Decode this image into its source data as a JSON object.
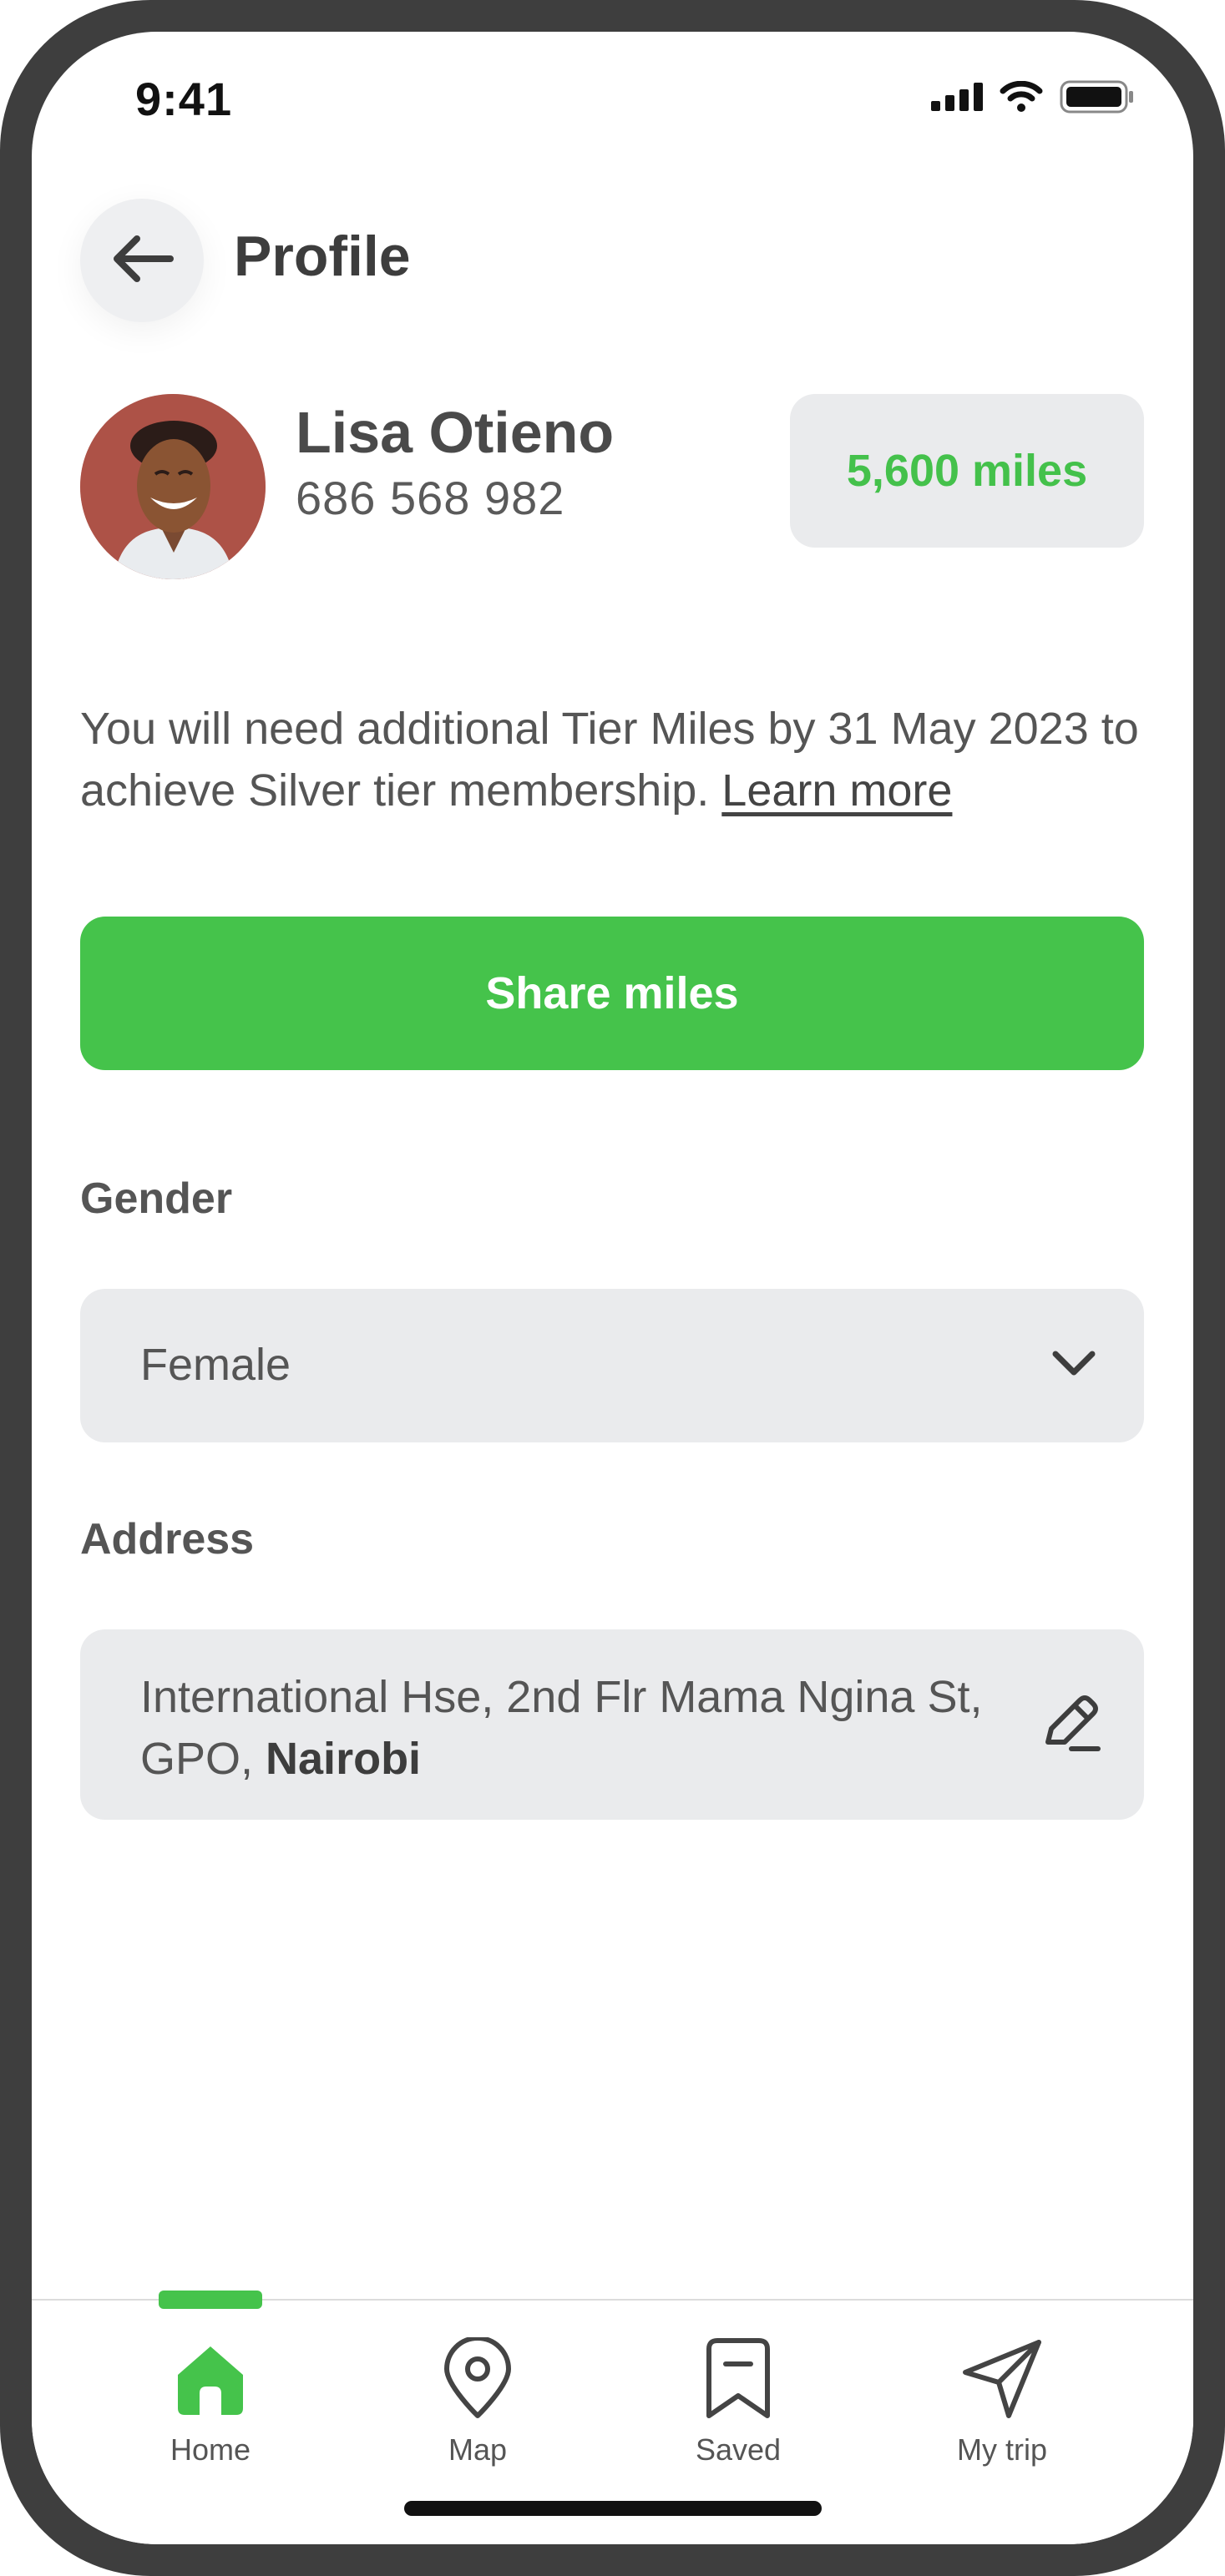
{
  "status_bar": {
    "time": "9:41"
  },
  "header": {
    "title": "Profile"
  },
  "profile": {
    "name": "Lisa Otieno",
    "phone": "686 568 982",
    "miles": "5,600 miles"
  },
  "info": {
    "text": "You will need additional Tier Miles by 31 May 2023 to achieve Silver tier membership. ",
    "link": "Learn more"
  },
  "share_button": {
    "label": "Share miles"
  },
  "gender": {
    "label": "Gender",
    "value": "Female"
  },
  "address": {
    "label": "Address",
    "line": "International Hse, 2nd Flr Mama Ngina St, GPO, ",
    "city": "Nairobi"
  },
  "tabs": [
    {
      "label": "Home",
      "icon": "home-icon",
      "active": true
    },
    {
      "label": "Map",
      "icon": "map-pin-icon",
      "active": false
    },
    {
      "label": "Saved",
      "icon": "bookmark-icon",
      "active": false
    },
    {
      "label": "My trip",
      "icon": "send-icon",
      "active": false
    }
  ],
  "colors": {
    "accent": "#45c34b",
    "field_bg": "#eaebed",
    "frame": "#3e3e3e"
  }
}
